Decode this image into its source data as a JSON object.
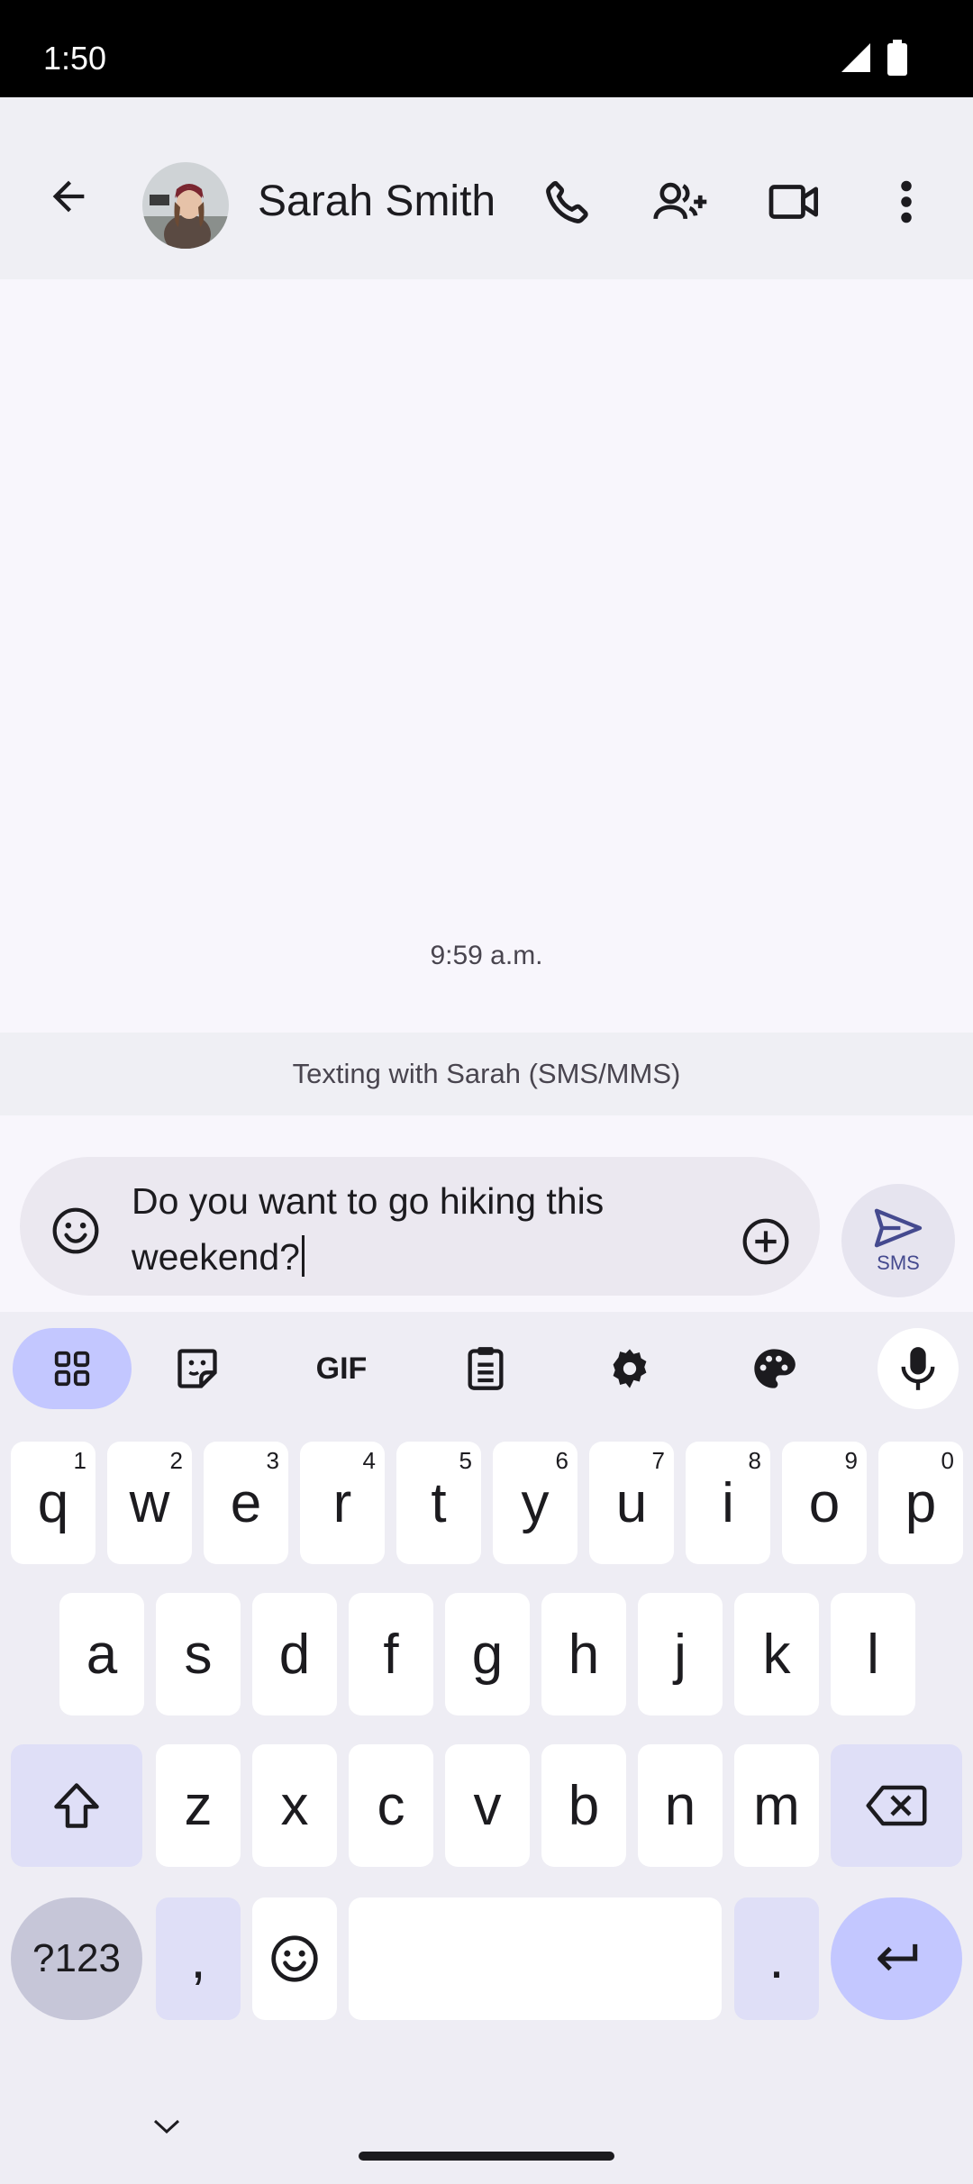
{
  "status_bar": {
    "time": "1:50"
  },
  "header": {
    "contact_name": "Sarah Smith"
  },
  "conversation": {
    "timestamp": "9:59 a.m."
  },
  "banner": {
    "text": "Texting with Sarah (SMS/MMS)"
  },
  "compose": {
    "message": "Do you want to go hiking this weekend?",
    "send_label": "SMS"
  },
  "keyboard": {
    "toolbar": {
      "gif_label": "GIF"
    },
    "row1": [
      {
        "label": "q",
        "hint": "1"
      },
      {
        "label": "w",
        "hint": "2"
      },
      {
        "label": "e",
        "hint": "3"
      },
      {
        "label": "r",
        "hint": "4"
      },
      {
        "label": "t",
        "hint": "5"
      },
      {
        "label": "y",
        "hint": "6"
      },
      {
        "label": "u",
        "hint": "7"
      },
      {
        "label": "i",
        "hint": "8"
      },
      {
        "label": "o",
        "hint": "9"
      },
      {
        "label": "p",
        "hint": "0"
      }
    ],
    "row2": [
      "a",
      "s",
      "d",
      "f",
      "g",
      "h",
      "j",
      "k",
      "l"
    ],
    "row3": [
      "z",
      "x",
      "c",
      "v",
      "b",
      "n",
      "m"
    ],
    "symbols_label": "?123",
    "comma_label": ",",
    "period_label": "."
  },
  "colors": {
    "accent": "#c3c7ff",
    "send_icon": "#454a8f",
    "key_background": "#ffffff",
    "modifier_key": "#dfdff7"
  }
}
